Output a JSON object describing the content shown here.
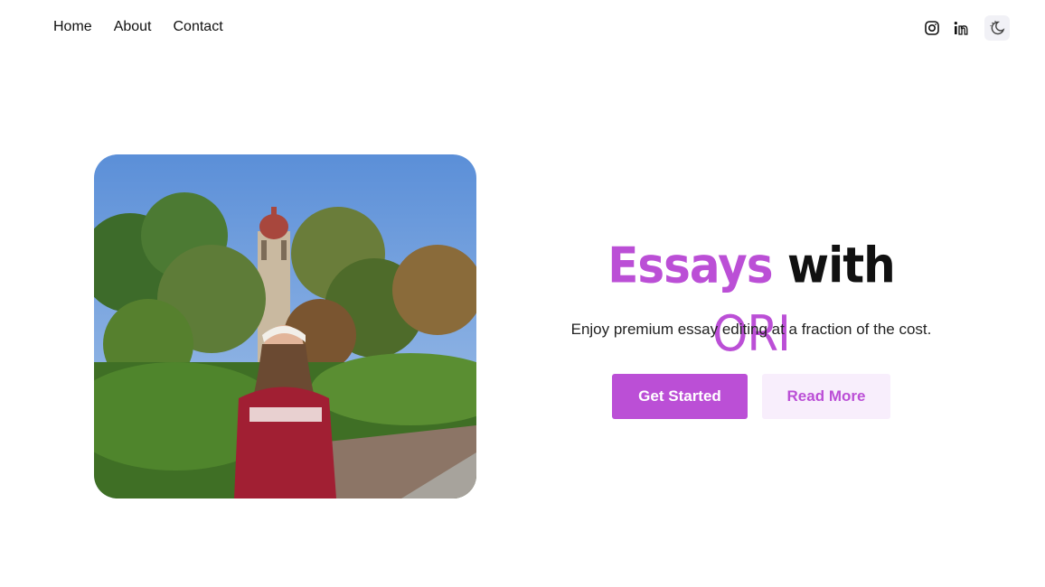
{
  "nav": {
    "items": [
      {
        "label": "Home"
      },
      {
        "label": "About"
      },
      {
        "label": "Contact"
      }
    ]
  },
  "social": {
    "icons": [
      "instagram-icon",
      "linkedin-icon"
    ],
    "theme_toggle_icon": "moon-stars-icon"
  },
  "hero": {
    "title_part1": "Essays",
    "title_part2": "with",
    "title_part3": "ORI",
    "subtitle": "Enjoy premium essay editing at a fraction of the cost.",
    "primary_button": "Get Started",
    "secondary_button": "Read More",
    "image_alt": "Student in Stanford sweatshirt in front of Hoover Tower"
  },
  "colors": {
    "accent": "#bb4fd6",
    "accent_soft": "#f8eefc",
    "text": "#111111"
  }
}
